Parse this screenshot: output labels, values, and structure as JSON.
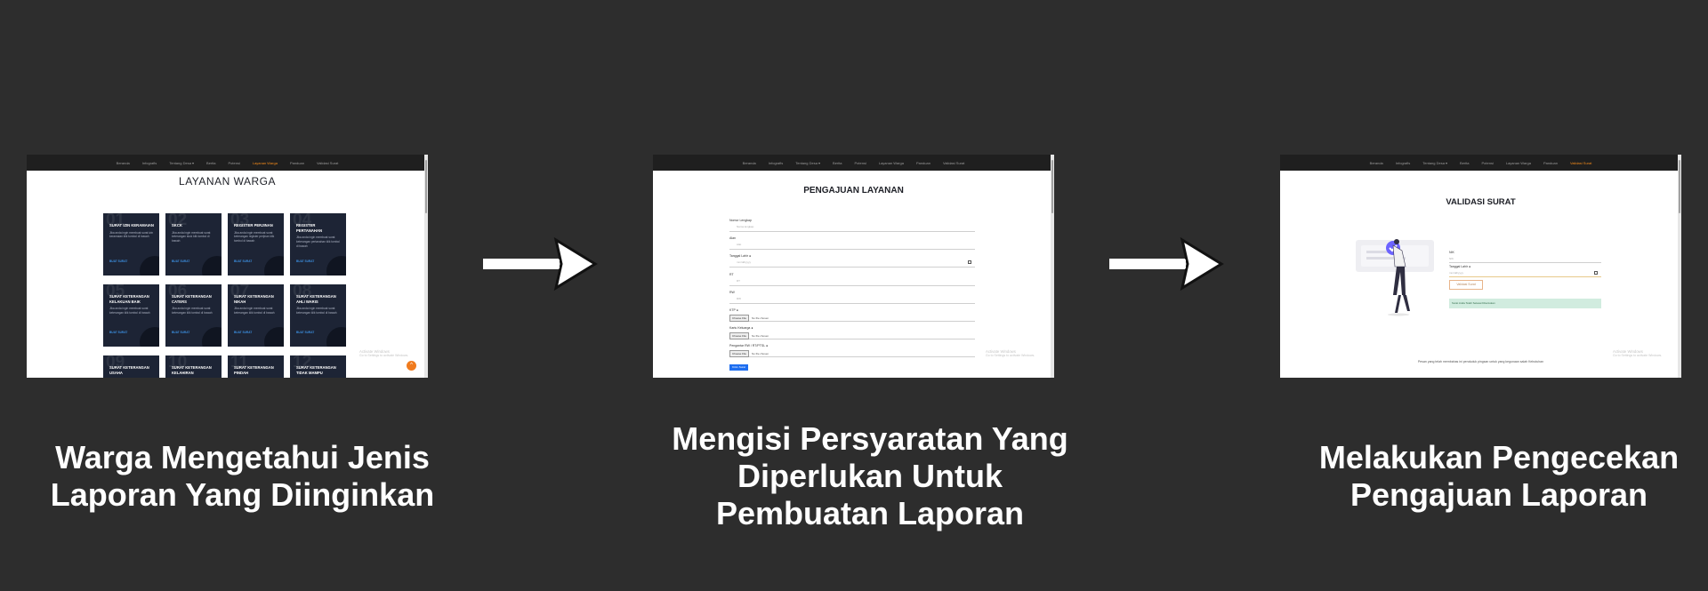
{
  "colors": {
    "background": "#2d2d2d",
    "nav_bg": "#1f1f1f",
    "nav_active": "#f28a1a",
    "card_bg": "#1d2435",
    "link_blue": "#3c8fe0",
    "submit_blue": "#1e6ef0",
    "alert_green": "#d1ecdf"
  },
  "steps": [
    {
      "caption_line1": "Warga Mengetahui Jenis",
      "caption_line2": "Laporan Yang Diinginkan",
      "screenshot": {
        "nav": [
          "Beranda",
          "Infografis",
          "Tentang Desa ▾",
          "Berita",
          "Potensi",
          "Layanan Warga",
          "Panduan",
          "Validasi Surat"
        ],
        "active_nav": "Layanan Warga",
        "title": "LAYANAN WARGA",
        "cards": [
          {
            "num": "01",
            "title": "SURAT IZIN KERAMAIAN",
            "desc": "Jika anda ingin membuat surat izin keramaian klik tombol di bawah",
            "link": "BUAT SURAT"
          },
          {
            "num": "02",
            "title": "SKCK",
            "desc": "Jika anda ingin membuat surat keterangan skck klik tombol di bawah",
            "link": "BUAT SURAT"
          },
          {
            "num": "03",
            "title": "REGISTER PERJINAN",
            "desc": "Jika anda ingin membuat surat keterangan register perjinan klik tombol di bawah",
            "link": "BUAT SURAT"
          },
          {
            "num": "04",
            "title": "REGISTER PERTANAHAN",
            "desc": "Jika anda ingin membuat surat keterangan pertanahan klik tombol di bawah",
            "link": "BUAT SURAT"
          },
          {
            "num": "05",
            "title": "SURAT KETERANGAN KELAKUAN BAIK",
            "desc": "Jika anda ingin membuat surat keterangan klik tombol di bawah",
            "link": "BUAT SURAT"
          },
          {
            "num": "06",
            "title": "SURAT KETERANGAN CATERS",
            "desc": "Jika anda ingin membuat surat keterangan klik tombol di bawah",
            "link": "BUAT SURAT"
          },
          {
            "num": "07",
            "title": "SURAT KETERANGAN NIKAH",
            "desc": "Jika anda ingin membuat surat keterangan klik tombol di bawah",
            "link": "BUAT SURAT"
          },
          {
            "num": "08",
            "title": "SURAT KETERANGAN AHLI WARIS",
            "desc": "Jika anda ingin membuat surat keterangan klik tombol di bawah",
            "link": "BUAT SURAT"
          },
          {
            "num": "09",
            "title": "SURAT KETERANGAN USAHA",
            "desc": "",
            "link": ""
          },
          {
            "num": "10",
            "title": "SURAT KETERANGAN KELAHIRAN",
            "desc": "",
            "link": ""
          },
          {
            "num": "11",
            "title": "SURAT KETERANGAN PINDAH",
            "desc": "",
            "link": ""
          },
          {
            "num": "12",
            "title": "SURAT KETERANGAN TIDAK MAMPU",
            "desc": "",
            "link": ""
          }
        ],
        "watermark_1": "Activate Windows",
        "watermark_2": "Go to Settings to activate Windows.",
        "fab_icon": "^"
      }
    },
    {
      "caption_line1": "Mengisi Persyaratan Yang",
      "caption_line2": "Diperlukan Untuk",
      "caption_line3": "Pembuatan Laporan",
      "screenshot": {
        "nav": [
          "Beranda",
          "Infografis",
          "Tentang Desa ▾",
          "Berita",
          "Potensi",
          "Layanan Warga",
          "Panduan",
          "Validasi Surat"
        ],
        "title": "PENGAJUAN LAYANAN",
        "fields": [
          {
            "label": "Nomor Lengkap",
            "value": "Nama lengkap"
          },
          {
            "label": "Alan",
            "value": "Alat"
          },
          {
            "label": "Tanggal Lahir ●",
            "value": "mm/dd/yyyy"
          },
          {
            "label": "RT",
            "value": "RT"
          },
          {
            "label": "RW",
            "value": "RW"
          }
        ],
        "file_fields": [
          {
            "label": "KTP ●",
            "button": "Choose File",
            "status": "No file chosen"
          },
          {
            "label": "Kartu Keluarga ●",
            "button": "Choose File",
            "status": "No file chosen"
          },
          {
            "label": "Pengantar RW / RT/PTSL ●",
            "button": "Choose File",
            "status": "No file chosen"
          }
        ],
        "submit": "Kirim Surat",
        "watermark_1": "Activate Windows",
        "watermark_2": "Go to Settings to activate Windows."
      }
    },
    {
      "caption_line1": "Melakukan Pengecekan",
      "caption_line2": "Pengajuan Laporan",
      "screenshot": {
        "nav": [
          "Beranda",
          "Infografis",
          "Tentang Desa ▾",
          "Berita",
          "Potensi",
          "Layanan Warga",
          "Panduan",
          "Validasi Surat"
        ],
        "active_nav": "Validasi Surat",
        "title": "VALIDASI SURAT",
        "fields": [
          {
            "label": "NIK",
            "value": "NIK"
          },
          {
            "label": "Tanggal Lahir ●",
            "value": "mm/dd/yyyy"
          }
        ],
        "check_button": "Validasi Surat",
        "alert": "Surat Anda Telah Selesai Ditentukan",
        "footer": "Pesan yang telah membahas ini penduduk pingsan untuk yang kegunaan salah Kebutuhan",
        "watermark_1": "Activate Windows",
        "watermark_2": "Go to Settings to activate Windows."
      }
    }
  ]
}
